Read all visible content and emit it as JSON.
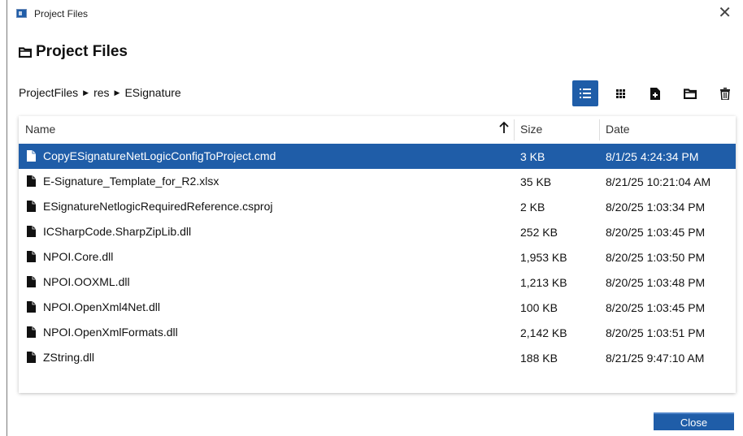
{
  "window": {
    "title": "Project Files",
    "close_glyph": "✕"
  },
  "header": {
    "title": "Project Files",
    "icon": "folder-icon"
  },
  "breadcrumb": {
    "items": [
      "ProjectFiles",
      "res",
      "ESignature"
    ],
    "separator": "▶"
  },
  "toolbar": {
    "buttons": [
      {
        "name": "list-view",
        "icon": "list-view-icon",
        "active": true
      },
      {
        "name": "grid-view",
        "icon": "grid-view-icon",
        "active": false
      },
      {
        "name": "new-file",
        "icon": "new-file-icon",
        "active": false
      },
      {
        "name": "new-folder",
        "icon": "new-folder-icon",
        "active": false
      },
      {
        "name": "delete",
        "icon": "trash-icon",
        "active": false
      }
    ]
  },
  "table": {
    "columns": {
      "name": "Name",
      "size": "Size",
      "date": "Date"
    },
    "sort": {
      "column": "name",
      "direction": "ascending"
    },
    "rows": [
      {
        "name": "CopyESignatureNetLogicConfigToProject.cmd",
        "size": "3 KB",
        "date": "8/1/25 4:24:34 PM",
        "selected": true
      },
      {
        "name": "E-Signature_Template_for_R2.xlsx",
        "size": "35 KB",
        "date": "8/21/25 10:21:04 AM",
        "selected": false
      },
      {
        "name": "ESignatureNetlogicRequiredReference.csproj",
        "size": "2 KB",
        "date": "8/20/25 1:03:34 PM",
        "selected": false
      },
      {
        "name": "ICSharpCode.SharpZipLib.dll",
        "size": "252 KB",
        "date": "8/20/25 1:03:45 PM",
        "selected": false
      },
      {
        "name": "NPOI.Core.dll",
        "size": "1,953 KB",
        "date": "8/20/25 1:03:50 PM",
        "selected": false
      },
      {
        "name": "NPOI.OOXML.dll",
        "size": "1,213 KB",
        "date": "8/20/25 1:03:48 PM",
        "selected": false
      },
      {
        "name": "NPOI.OpenXml4Net.dll",
        "size": "100 KB",
        "date": "8/20/25 1:03:45 PM",
        "selected": false
      },
      {
        "name": "NPOI.OpenXmlFormats.dll",
        "size": "2,142 KB",
        "date": "8/20/25 1:03:51 PM",
        "selected": false
      },
      {
        "name": "ZString.dll",
        "size": "188 KB",
        "date": "8/21/25 9:47:10 AM",
        "selected": false
      }
    ]
  },
  "footer": {
    "close_label": "Close"
  },
  "colors": {
    "accent": "#1f5da8",
    "text": "#1a1a1a",
    "selected_text": "#ffffff"
  }
}
